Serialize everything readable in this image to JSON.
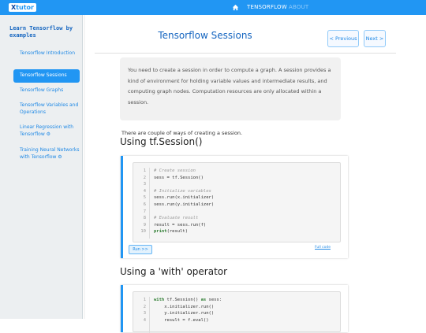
{
  "header": {
    "logo_x": "X",
    "logo_text": "tutor",
    "nav_tensorflow": "TENSORFLOW",
    "nav_about": "ABOUT",
    "home_icon": "home-icon"
  },
  "sidebar": {
    "title": "Learn Tensorflow by examples",
    "items": [
      {
        "label": "Tensorflow Introduction"
      },
      {
        "label": "Tensorflow Sessions"
      },
      {
        "label": "Tensorflow Graphs"
      },
      {
        "label": "Tensorflow Variables and Operations"
      },
      {
        "label": "Linear Regression with Tensorflow ⚙"
      },
      {
        "label": "Training Neural Networks with Tensorflow ⚙"
      }
    ]
  },
  "main": {
    "title": "Tensorflow Sessions",
    "prev_label": "< Previous",
    "next_label": "Next >",
    "intro": "You need to create a session in order to compute a graph. A session provides a kind of environment for holding variable values and intermediate results, and computing graph nodes. Computation resources are only allocated within a session.",
    "para": "There are couple of ways of creating a session.",
    "section1_title": "Using tf.Session()",
    "section2_title": "Using a 'with' operator",
    "run_label": "Run >>",
    "full_code_label": "Full code",
    "code1": [
      {
        "n": "1",
        "t": "# Create session",
        "c": "cm"
      },
      {
        "n": "2",
        "t": "sess = tf.Session()",
        "c": ""
      },
      {
        "n": "3",
        "t": "",
        "c": ""
      },
      {
        "n": "4",
        "t": "# Initialize variables",
        "c": "cm"
      },
      {
        "n": "5",
        "t": "sess.run(x.initializer)",
        "c": ""
      },
      {
        "n": "6",
        "t": "sess.run(y.initializer)",
        "c": ""
      },
      {
        "n": "7",
        "t": "",
        "c": ""
      },
      {
        "n": "8",
        "t": "# Evaluate result",
        "c": "cm"
      },
      {
        "n": "9",
        "t": "result = sess.run(f)",
        "c": ""
      },
      {
        "n": "10",
        "t": "print(result)",
        "c": "print"
      }
    ],
    "code2": [
      {
        "n": "1",
        "t": "with tf.Session() as sess:",
        "c": "with"
      },
      {
        "n": "2",
        "t": "    x.initializer.run()",
        "c": ""
      },
      {
        "n": "3",
        "t": "    y.initializer.run()",
        "c": ""
      },
      {
        "n": "4",
        "t": "    result = f.eval()",
        "c": ""
      }
    ]
  }
}
